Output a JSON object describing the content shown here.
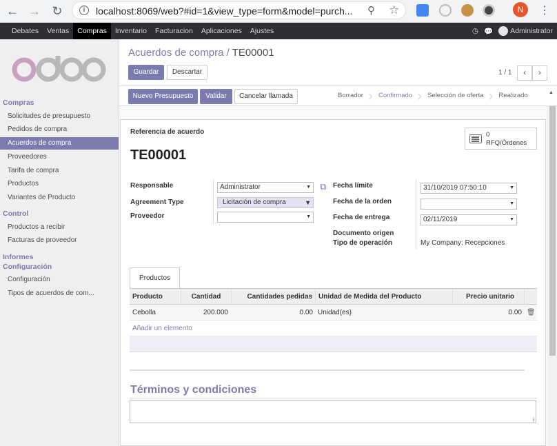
{
  "browser": {
    "url": "localhost:8069/web?#id=1&view_type=form&model=purch...",
    "profile_initial": "N"
  },
  "topbar": {
    "menu": [
      "Debates",
      "Ventas",
      "Compras",
      "Inventario",
      "Facturacion",
      "Aplicaciones",
      "Ajustes"
    ],
    "active_menu": "Compras",
    "user": "Administrator"
  },
  "sidebar": {
    "sections": [
      {
        "title": "Compras",
        "items": [
          "Solicitudes de presupuesto",
          "Pedidos de compra",
          "Acuerdos de compra",
          "Proveedores",
          "Tarifa de compra",
          "Productos",
          "Variantes de Producto"
        ]
      },
      {
        "title": "Control",
        "items": [
          "Productos a recibir",
          "Facturas de proveedor"
        ]
      },
      {
        "title": "Informes",
        "items": []
      },
      {
        "title": "Configuración",
        "items": [
          "Configuración",
          "Tipos de acuerdos de com..."
        ]
      }
    ],
    "active_item": "Acuerdos de compra"
  },
  "breadcrumb": {
    "parent": "Acuerdos de compra /",
    "current": "TE00001"
  },
  "controls": {
    "save": "Guardar",
    "discard": "Descartar",
    "pager": "1 / 1"
  },
  "statusbar": {
    "buttons": [
      "Nuevo Presupuesto",
      "Validar",
      "Cancelar llamada"
    ],
    "stages": [
      "Borrador",
      "Confirmado",
      "Selección de oferta",
      "Realizado"
    ],
    "current_stage": "Confirmado"
  },
  "form": {
    "ref_label": "Referencia de acuerdo",
    "ref_value": "TE00001",
    "smart_button": {
      "count": "0",
      "label": "RFQ/Órdenes"
    },
    "left": {
      "responsable_label": "Responsable",
      "responsable_value": "Administrator",
      "agreement_type_label": "Agreement Type",
      "agreement_type_value": "Licitación de compra",
      "proveedor_label": "Proveedor",
      "proveedor_value": ""
    },
    "right": {
      "fecha_limite_label": "Fecha límite",
      "fecha_limite_value": "31/10/2019 07:50:10",
      "fecha_orden_label": "Fecha de la orden",
      "fecha_orden_value": "",
      "fecha_entrega_label": "Fecha de entrega",
      "fecha_entrega_value": "02/11/2019",
      "documento_label": "Documento origen",
      "tipo_op_label": "Tipo de operación",
      "tipo_op_value": "My Company: Recepciones"
    },
    "tab": "Productos",
    "table": {
      "headers": [
        "Producto",
        "Cantidad",
        "Cantidades pedidas",
        "Unidad de Medida del Producto",
        "Precio unitario"
      ],
      "rows": [
        {
          "producto": "Cebolla",
          "cantidad": "200.000",
          "pedidas": "0.00",
          "uom": "Unidad(es)",
          "precio": "0.00"
        }
      ],
      "add_line": "Añadir un elemento"
    },
    "terms_title": "Términos y condiciones"
  },
  "colors": {
    "accent": "#7c7bad",
    "topbar": "#2f2f33",
    "sidebar_bg": "#f0eeee"
  }
}
